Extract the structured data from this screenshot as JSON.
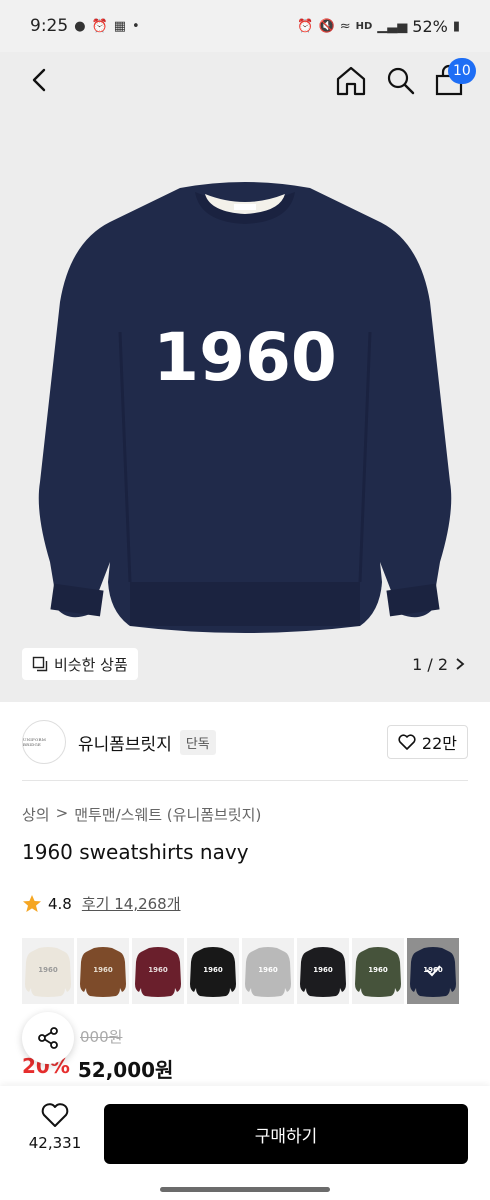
{
  "status_bar": {
    "time": "9:25",
    "battery": "52%",
    "network": "HD"
  },
  "nav": {
    "cart_count": "10"
  },
  "hero": {
    "similar_label": "비슷한 상품",
    "pager": "1 / 2",
    "graphic_text": "1960"
  },
  "brand": {
    "name": "유니폼브릿지",
    "tag": "단독",
    "logo_text": "UNIFORM BRIDGE",
    "likes": "22만"
  },
  "product": {
    "breadcrumb": [
      "상의",
      "맨투맨/스웨트 (유니폼브릿지)"
    ],
    "title": "1960 sweatshirts navy",
    "rating": "4.8",
    "review_link": "후기 14,268개",
    "original_price": "000원",
    "discount": "20%",
    "price": "52,000원"
  },
  "swatches": [
    {
      "name": "ivory",
      "color": "#ebe6dc",
      "text_color": "#9a9a9a",
      "selected": false
    },
    {
      "name": "brown",
      "color": "#7d4b2a",
      "text_color": "#e9e0d3",
      "selected": false
    },
    {
      "name": "burgundy",
      "color": "#6a1f2c",
      "text_color": "#e9dede",
      "selected": false
    },
    {
      "name": "black",
      "color": "#181818",
      "text_color": "#ffffff",
      "selected": false
    },
    {
      "name": "melange",
      "color": "#b9b9b9",
      "text_color": "#ffffff",
      "selected": false
    },
    {
      "name": "charcoal",
      "color": "#1c1c1f",
      "text_color": "#ffffff",
      "selected": false
    },
    {
      "name": "khaki",
      "color": "#46533b",
      "text_color": "#ffffff",
      "selected": false
    },
    {
      "name": "navy",
      "color": "#1c2540",
      "text_color": "#ffffff",
      "selected": true
    }
  ],
  "bottom": {
    "likes": "42,331",
    "buy_label": "구매하기"
  },
  "colors": {
    "accent_badge": "#1e6ef5",
    "discount": "#e62e2e",
    "sweater_navy": "#202a4a"
  }
}
